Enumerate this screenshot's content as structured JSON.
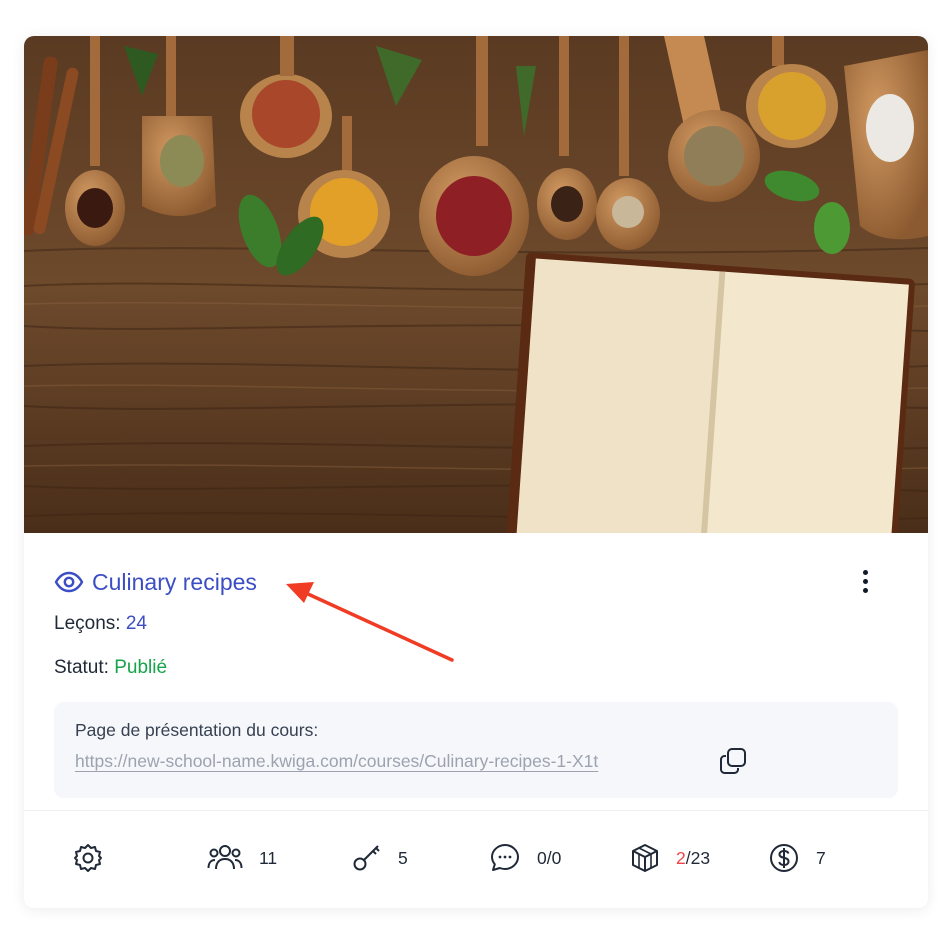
{
  "course": {
    "title": "Culinary recipes",
    "lessons_label": "Leçons:",
    "lessons_count": "24",
    "status_label": "Statut:",
    "status_value": "Publié",
    "presentation_label": "Page de présentation du cours:",
    "presentation_url": "https://new-school-name.kwiga.com/courses/Culinary-recipes-1-X1t"
  },
  "stats": {
    "students": "11",
    "keys": "5",
    "comments": "0/0",
    "tasks_done": "2",
    "tasks_total": "/23",
    "payments": "7"
  },
  "colors": {
    "accent": "#3b4ec4",
    "status_green": "#16a34a",
    "annotation_arrow": "#f03c24",
    "tasks_red": "#ef4444"
  },
  "icons": {
    "visibility": "eye-icon",
    "menu": "more-vertical-icon",
    "copy": "copy-icon",
    "settings": "gear-icon",
    "students": "users-icon",
    "keys": "key-icon",
    "comments": "chat-icon",
    "tasks": "cube-icon",
    "payments": "dollar-icon"
  }
}
